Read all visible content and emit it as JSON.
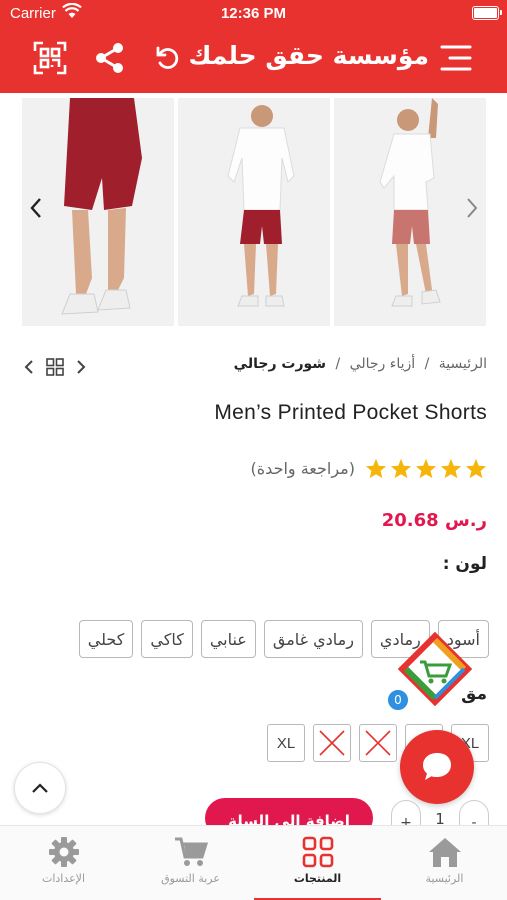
{
  "status_bar": {
    "carrier": "Carrier",
    "time": "12:36 PM"
  },
  "header": {
    "title": "مؤسسة حقق حلمك"
  },
  "breadcrumb": {
    "home": "الرئيسية",
    "category": "أزياء رجالي",
    "current": "شورت رجالي",
    "sep": "/"
  },
  "product": {
    "title": "Men’s Printed Pocket Shorts",
    "rating": 5,
    "reviews_label": "(مراجعة واحدة)",
    "price": "ر.س 20.68",
    "color_label": "لون :",
    "size_label": "مق",
    "colors": [
      "أسود",
      "رمادي",
      "رمادي غامق",
      "عنابي",
      "كاكي",
      "كحلي"
    ],
    "sizes": [
      {
        "label": "XL",
        "available": true
      },
      {
        "label": "L",
        "available": true
      },
      {
        "label": "",
        "available": false
      },
      {
        "label": "",
        "available": false
      },
      {
        "label": "XL",
        "available": true
      }
    ]
  },
  "cart": {
    "count": "0",
    "add_label": "إضافة إلى السلة",
    "quantity": "1",
    "plus": "+",
    "minus": "-"
  },
  "tabs": [
    {
      "label": "الرئيسية",
      "icon": "home-icon"
    },
    {
      "label": "المنتجات",
      "icon": "grid-icon",
      "active": true
    },
    {
      "label": "عربة التسوق",
      "icon": "cart-icon"
    },
    {
      "label": "الإعدادات",
      "icon": "gear-icon"
    }
  ],
  "colors": {
    "primary": "#e8322f",
    "price": "#e0184d",
    "star": "#f5b50a",
    "badge": "#2f8fe0"
  }
}
